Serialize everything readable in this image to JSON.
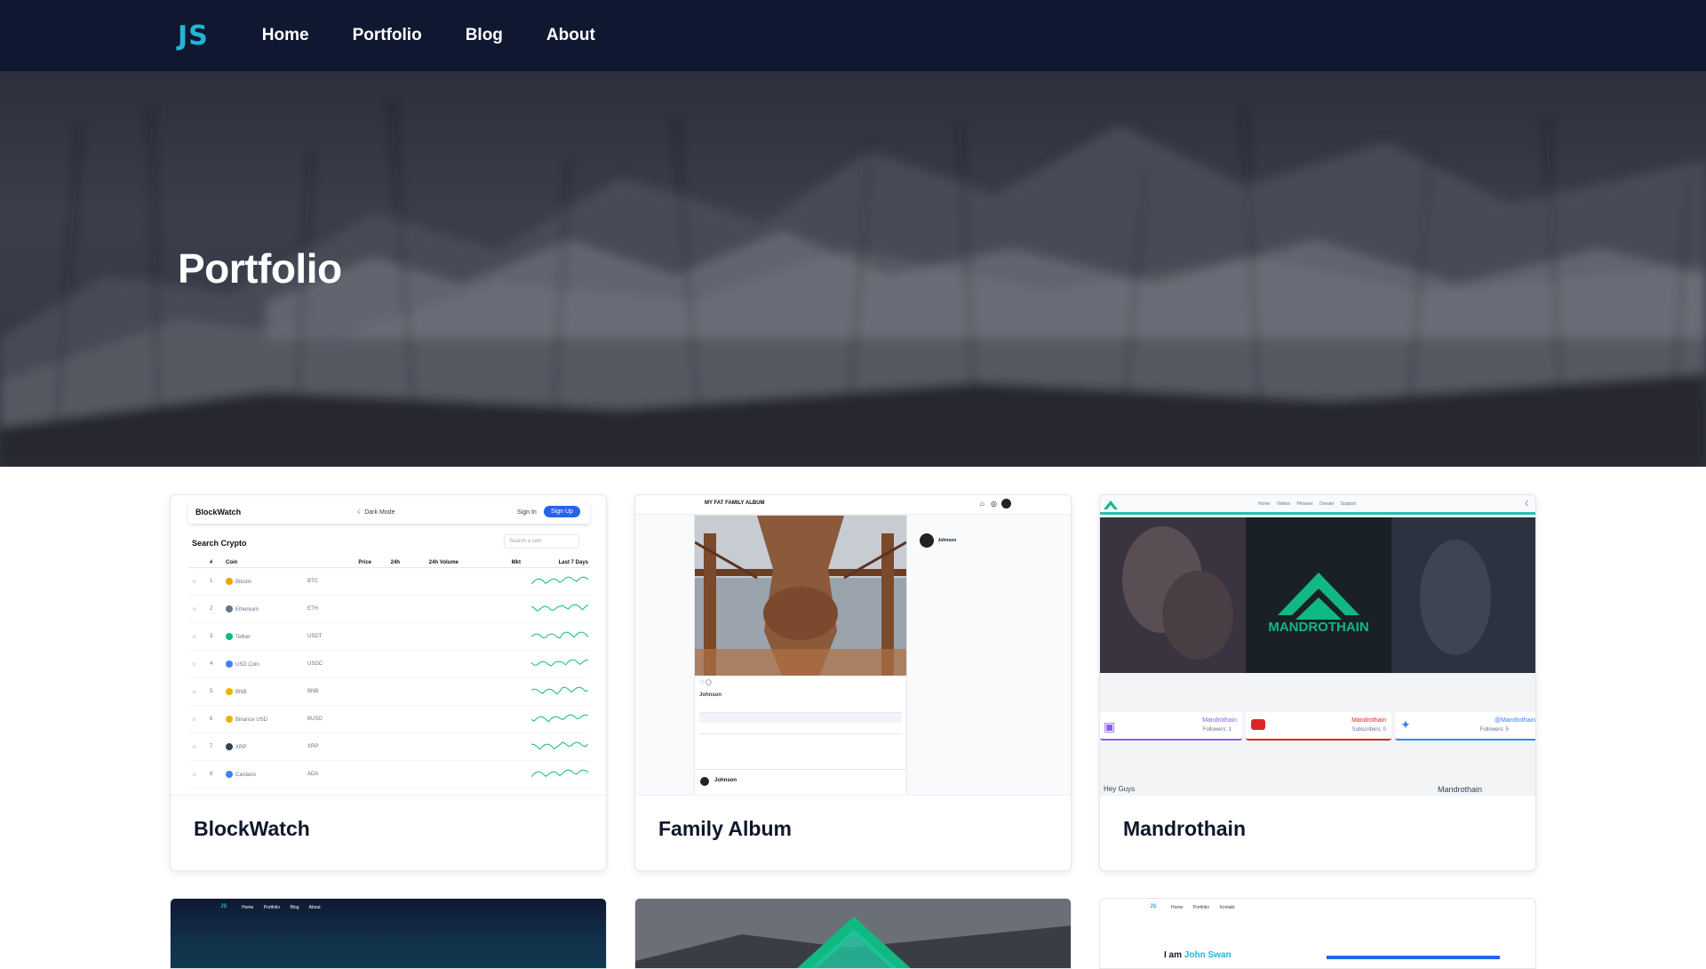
{
  "nav": {
    "logo": "JS",
    "links": [
      "Home",
      "Portfolio",
      "Blog",
      "About"
    ]
  },
  "hero": {
    "title": "Portfolio"
  },
  "projects": [
    {
      "title": "BlockWatch"
    },
    {
      "title": "Family Album"
    },
    {
      "title": "Mandrothain"
    }
  ],
  "blockwatch_shot": {
    "brand": "BlockWatch",
    "dark_mode": "Dark Mode",
    "sign_in": "Sign In",
    "sign_up": "Sign Up",
    "search_title": "Search Crypto",
    "search_placeholder": "Search a coin",
    "columns": [
      "#",
      "Coin",
      "Price",
      "24h",
      "24h Volume",
      "Mkt",
      "Last 7 Days"
    ],
    "rows": [
      {
        "n": "1",
        "coin": "Bitcoin",
        "sym": "BTC",
        "color": "#f59e0b"
      },
      {
        "n": "2",
        "coin": "Ethereum",
        "sym": "ETH",
        "color": "#64748b"
      },
      {
        "n": "3",
        "coin": "Tether",
        "sym": "USDT",
        "color": "#10b981"
      },
      {
        "n": "4",
        "coin": "USD Coin",
        "sym": "USDC",
        "color": "#3b82f6"
      },
      {
        "n": "5",
        "coin": "BNB",
        "sym": "BNB",
        "color": "#eab308"
      },
      {
        "n": "6",
        "coin": "Binance USD",
        "sym": "BUSD",
        "color": "#eab308"
      },
      {
        "n": "7",
        "coin": "XRP",
        "sym": "XRP",
        "color": "#334155"
      },
      {
        "n": "8",
        "coin": "Cardano",
        "sym": "ADA",
        "color": "#3b82f6"
      }
    ]
  },
  "family_shot": {
    "brand": "MY FAT FAMILY ALBUM",
    "user": "Johnson"
  },
  "mandro_shot": {
    "logo": "MANDROTHAIN",
    "nav": [
      "Home",
      "Videos",
      "Phrases",
      "Donate",
      "Support"
    ],
    "social": [
      {
        "name": "Mandrothain",
        "sub": "Followers: 1"
      },
      {
        "name": "Mandrothain",
        "sub": "Subscribers: 0"
      },
      {
        "name": "@Mandrothain",
        "sub": "Followers: 5"
      }
    ],
    "greeting": "Hey Guys",
    "side": "Mandrothain"
  },
  "next_row": {
    "nav_logo": "JS",
    "nav_links": [
      "Home",
      "Portfolio",
      "Blog",
      "About"
    ],
    "third_nav": [
      "Home",
      "Portfolio",
      "Kontakt"
    ],
    "intro_prefix": "I am",
    "intro_name": "John Swan"
  },
  "colors": {
    "nav_bg": "#0f1830",
    "logo": "#22b5d8",
    "mandro_green": "#10b981",
    "brand_blue": "#2563eb"
  }
}
